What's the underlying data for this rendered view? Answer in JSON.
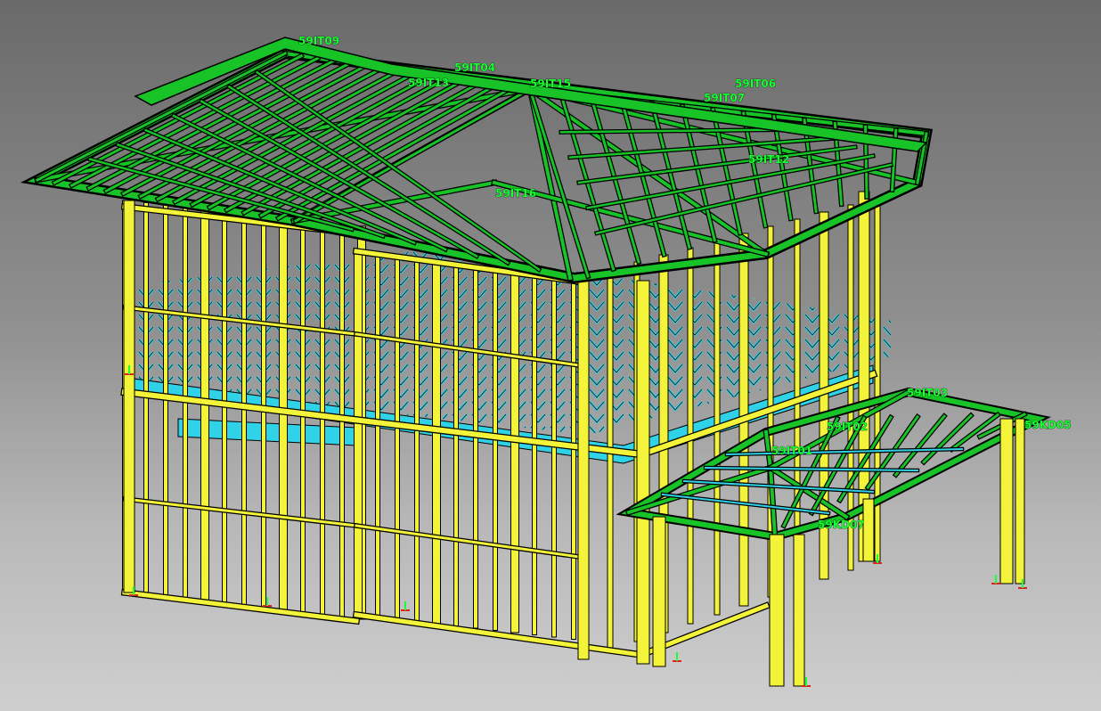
{
  "colors": {
    "background_top": "#6a6a6a",
    "background_bottom": "#cfcfcf",
    "stud": "#f3f33a",
    "roof_member": "#17c326",
    "joist": "#2fd2e6",
    "outline": "#000000",
    "label": "#19ff33",
    "marker": "#e0201e"
  },
  "labels": {
    "truss_a": "59IT09",
    "truss_b": "59IT04",
    "truss_c": "59IT15",
    "truss_d": "59IT06",
    "truss_e": "59IT07",
    "truss_f": "59IT13",
    "truss_g": "59IT12",
    "truss_h": "59IT16",
    "porch_truss_a": "59IT02",
    "porch_truss_b": "59IT01",
    "porch_truss_c": "59IT03",
    "porch_member_a": "59KD07",
    "porch_member_b": "59KD05"
  }
}
